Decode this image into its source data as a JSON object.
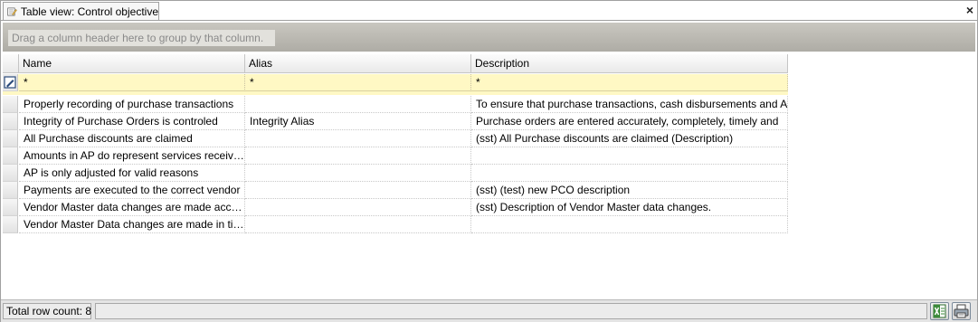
{
  "tab": {
    "title": "Table view: Control objective",
    "icon": "edit-table-icon"
  },
  "close_label": "×",
  "group_panel": {
    "placeholder": "Drag a column header here to group by that column."
  },
  "columns": [
    "Name",
    "Alias",
    "Description"
  ],
  "filter_row": {
    "icon": "filter-edit-icon",
    "name": "*",
    "alias": "*",
    "description": "*"
  },
  "rows": [
    {
      "name": "Properly recording of purchase transactions",
      "alias": "",
      "description": "To ensure that purchase transactions, cash disbursements and A/P"
    },
    {
      "name": "Integrity of Purchase Orders is controled",
      "alias": "Integrity Alias",
      "description": "Purchase orders are entered accurately, completely, timely and"
    },
    {
      "name": "All Purchase discounts are claimed",
      "alias": "",
      "description": "(sst) All Purchase discounts are claimed (Description)"
    },
    {
      "name": "Amounts in AP do represent services received",
      "alias": "",
      "description": ""
    },
    {
      "name": "AP is only adjusted for valid reasons",
      "alias": "",
      "description": ""
    },
    {
      "name": "Payments are executed to the correct vendor",
      "alias": "",
      "description": "(sst) (test) new PCO description"
    },
    {
      "name": "Vendor Master data changes are made accura...",
      "alias": "",
      "description": "(sst) Description of Vendor Master data changes."
    },
    {
      "name": "Vendor Master Data changes are made in time",
      "alias": "",
      "description": ""
    }
  ],
  "footer": {
    "row_count": "Total row count: 8",
    "buttons": [
      "excel-export-icon",
      "print-icon"
    ]
  }
}
